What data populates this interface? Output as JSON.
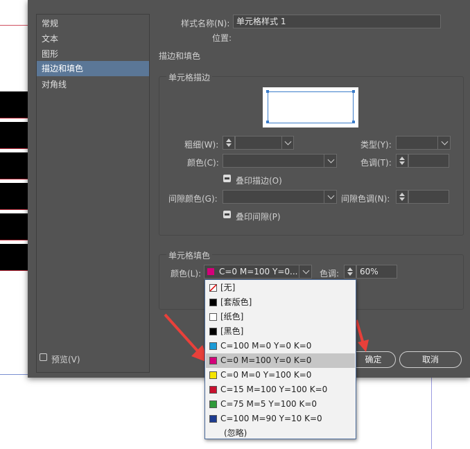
{
  "nav": {
    "items": [
      {
        "label": "常规"
      },
      {
        "label": "文本"
      },
      {
        "label": "图形"
      },
      {
        "label": "描边和填色"
      },
      {
        "label": "对角线"
      }
    ],
    "selected_index": 3
  },
  "header": {
    "style_name_label": "样式名称(N):",
    "style_name_value": "单元格样式 1",
    "location_label": "位置:",
    "section_title": "描边和填色"
  },
  "stroke_group": {
    "title": "单元格描边",
    "weight_label": "粗细(W):",
    "weight_value": "",
    "type_label": "类型(Y):",
    "type_value": "",
    "color_label": "颜色(C):",
    "color_value": "",
    "tint_label": "色调(T):",
    "tint_value": "",
    "overprint_stroke_label": "叠印描边(O)",
    "gap_color_label": "间隙颜色(G):",
    "gap_color_value": "",
    "gap_tint_label": "间隙色调(N):",
    "gap_tint_value": "",
    "overprint_gap_label": "叠印间隙(P)"
  },
  "fill_group": {
    "title": "单元格填色",
    "color_label": "颜色(L):",
    "color_value": "C=0 M=100 Y=0...",
    "color_swatch": "#d4007a",
    "tint_label": "色调:",
    "tint_value": "60%"
  },
  "footer": {
    "preview_label": "预览(V)",
    "ok_label": "确定",
    "cancel_label": "取消"
  },
  "swatch_list": {
    "options": [
      {
        "label": "[无]",
        "color": "none",
        "icon": "none-slash-icon"
      },
      {
        "label": "[套版色]",
        "color": "#000000",
        "icon": "registration-icon"
      },
      {
        "label": "[纸色]",
        "color": "#ffffff",
        "icon": "paper-icon"
      },
      {
        "label": "[黑色]",
        "color": "#000000",
        "icon": "black-icon"
      },
      {
        "label": "C=100 M=0 Y=0 K=0",
        "color": "#1a9ad6"
      },
      {
        "label": "C=0 M=100 Y=0 K=0",
        "color": "#d4007a"
      },
      {
        "label": "C=0 M=0 Y=100 K=0",
        "color": "#f5e400"
      },
      {
        "label": "C=15 M=100 Y=100 K=0",
        "color": "#c8102e"
      },
      {
        "label": "C=75 M=5 Y=100 K=0",
        "color": "#2f9a3a"
      },
      {
        "label": "C=100 M=90 Y=10 K=0",
        "color": "#1d3b8f"
      },
      {
        "label": "(忽略)",
        "color": null
      }
    ],
    "highlighted_index": 5
  },
  "colors": {
    "dialog_bg": "#535353",
    "selection": "#5b7797",
    "annotation_arrow": "#e8403a",
    "preview_stroke": "#3b7cc9"
  }
}
